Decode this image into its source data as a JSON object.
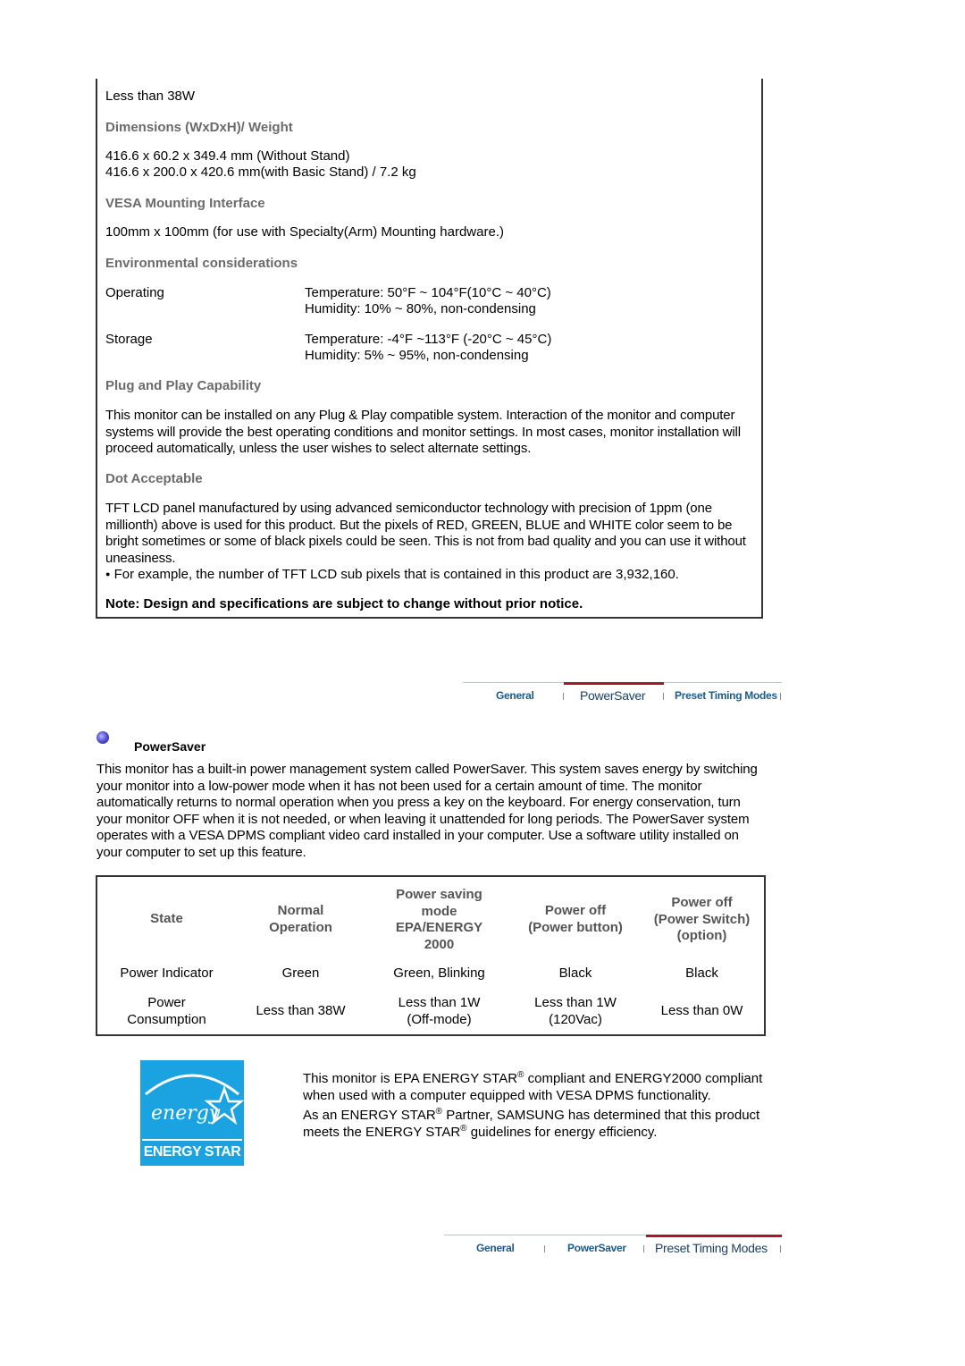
{
  "spec": {
    "power_line": "Less than 38W",
    "dimensions_head": "Dimensions (WxDxH)/ Weight",
    "dimensions_1": "416.6 x 60.2 x 349.4 mm (Without Stand)",
    "dimensions_2": "416.6 x 200.0 x 420.6 mm(with Basic Stand) / 7.2 kg",
    "vesa_head": "VESA Mounting Interface",
    "vesa_text": "100mm x 100mm (for use with Specialty(Arm) Mounting hardware.)",
    "env_head": "Environmental considerations",
    "operating_label": "Operating",
    "operating_temp": "Temperature: 50°F ~ 104°F(10°C ~ 40°C)",
    "operating_hum": "Humidity: 10% ~ 80%, non-condensing",
    "storage_label": "Storage",
    "storage_temp": "Temperature: -4°F ~113°F (-20°C ~ 45°C)",
    "storage_hum": "Humidity: 5% ~ 95%, non-condensing",
    "pnp_head": "Plug and Play Capability",
    "pnp_text": "This monitor can be installed on any Plug & Play compatible system. Interaction of the monitor and computer systems will provide the best operating conditions and monitor settings. In most cases, monitor installation will proceed automatically, unless the user wishes to select alternate settings.",
    "dot_head": "Dot Acceptable",
    "dot_text": "TFT LCD panel manufactured by using advanced semiconductor technology with precision of 1ppm (one millionth) above is used for this product. But the pixels of RED, GREEN, BLUE and WHITE color seem to be bright sometimes or some of black pixels could be seen. This is not from bad quality and you can use it without uneasiness.",
    "dot_bullet": "For example, the number of TFT LCD sub pixels that is contained in this product are 3,932,160.",
    "note": "Note: Design and specifications are subject to change without prior notice."
  },
  "tabs_top": {
    "items": [
      "General",
      "PowerSaver",
      "Preset Timing Modes"
    ],
    "active": "PowerSaver"
  },
  "powersaver": {
    "title": "PowerSaver",
    "text": "This monitor has a built-in power management system called PowerSaver. This system saves energy by switching your monitor into a low-power mode when it has not been used for a certain amount of time. The monitor automatically returns to normal operation when you press a key on the keyboard. For energy conservation, turn your monitor OFF when it is not needed, or when leaving it unattended for long periods. The PowerSaver system operates with a VESA DPMS compliant video card installed in your computer. Use a software utility installed on your computer to set up this feature."
  },
  "power_table": {
    "headers": [
      "State",
      "Normal Operation",
      "Power saving mode EPA/ENERGY 2000",
      "Power off (Power button)",
      "Power off (Power Switch) (option)"
    ],
    "header_lines": [
      [
        "State"
      ],
      [
        "Normal",
        "Operation"
      ],
      [
        "Power saving",
        "mode",
        "EPA/ENERGY",
        "2000"
      ],
      [
        "Power off",
        "(Power button)"
      ],
      [
        "Power off",
        "(Power Switch)",
        "(option)"
      ]
    ],
    "rows": [
      [
        [
          "Power Indicator"
        ],
        [
          "Green"
        ],
        [
          "Green, Blinking"
        ],
        [
          "Black"
        ],
        [
          "Black"
        ]
      ],
      [
        [
          "Power",
          "Consumption"
        ],
        [
          "Less than 38W"
        ],
        [
          "Less than 1W",
          "(Off-mode)"
        ],
        [
          "Less than 1W",
          "(120Vac)"
        ],
        [
          "Less than 0W"
        ]
      ]
    ]
  },
  "energy_star": {
    "logo_script": "energy",
    "logo_label": "ENERGY STAR",
    "p1_a": "This monitor is EPA ENERGY STAR",
    "p1_b": " compliant and ENERGY2000 compliant when used with a computer equipped with VESA DPMS functionality.",
    "p2_a": "As an ENERGY STAR",
    "p2_b": " Partner, SAMSUNG has determined that this product meets the ENERGY STAR",
    "p2_c": " guidelines for energy efficiency.",
    "reg": "®"
  },
  "tabs_bottom": {
    "items": [
      "General",
      "PowerSaver",
      "Preset Timing Modes"
    ],
    "active": "Preset Timing Modes"
  }
}
